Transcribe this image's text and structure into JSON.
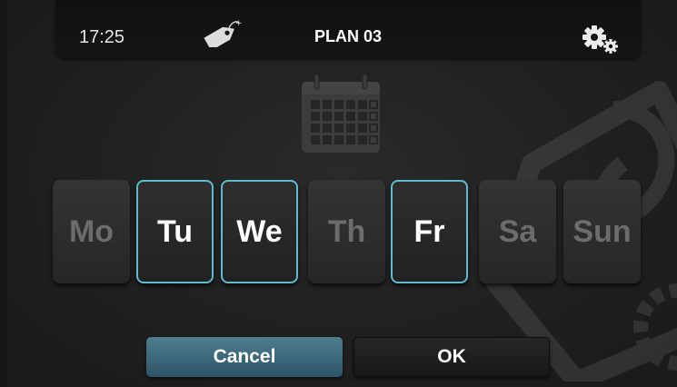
{
  "header": {
    "time": "17:25",
    "title": "PLAN 03",
    "tag_icon": "tag-icon",
    "settings_icon": "gear-icon"
  },
  "calendar_icon": "calendar-icon",
  "days": [
    {
      "label": "Mo",
      "selected": false
    },
    {
      "label": "Tu",
      "selected": true
    },
    {
      "label": "We",
      "selected": true
    },
    {
      "label": "Th",
      "selected": false
    },
    {
      "label": "Fr",
      "selected": true
    },
    {
      "label": "Sa",
      "selected": false
    },
    {
      "label": "Sun",
      "selected": false
    }
  ],
  "actions": {
    "cancel_label": "Cancel",
    "ok_label": "OK"
  },
  "colors": {
    "selected_border": "#5bbcd2",
    "cancel_button": "#3e6a7e",
    "unselected_text": "#6c6c6c"
  }
}
